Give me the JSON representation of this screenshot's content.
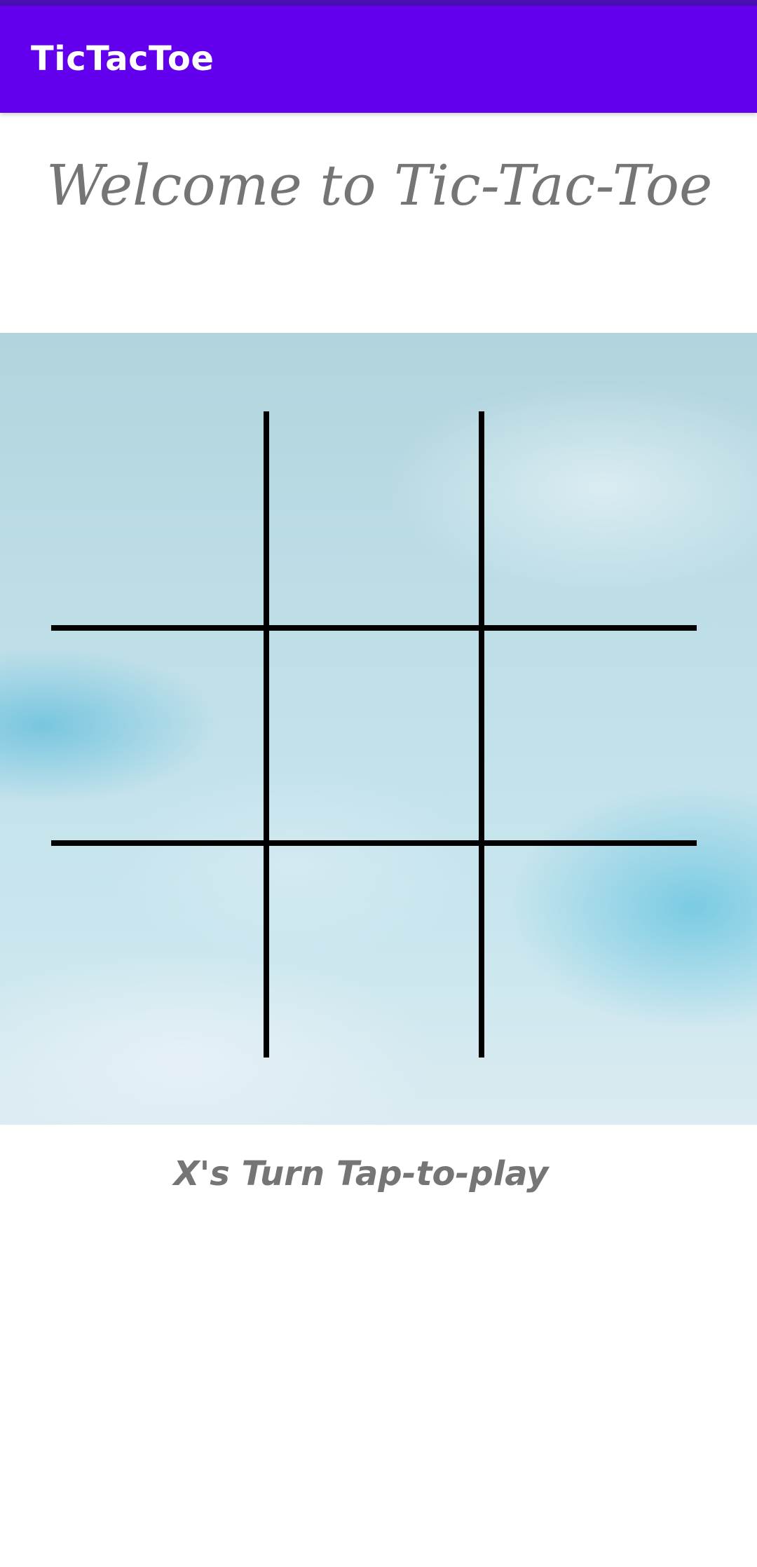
{
  "app_bar": {
    "title": "TicTacToe",
    "color": "#6200ee"
  },
  "welcome": {
    "text": "Welcome to Tic-Tac-Toe"
  },
  "board": {
    "rows": 3,
    "cols": 3,
    "cells": [
      "",
      "",
      "",
      "",
      "",
      "",
      "",
      "",
      ""
    ],
    "line_color": "#000000"
  },
  "status": {
    "turn_text": "X's Turn Tap-to-play"
  }
}
